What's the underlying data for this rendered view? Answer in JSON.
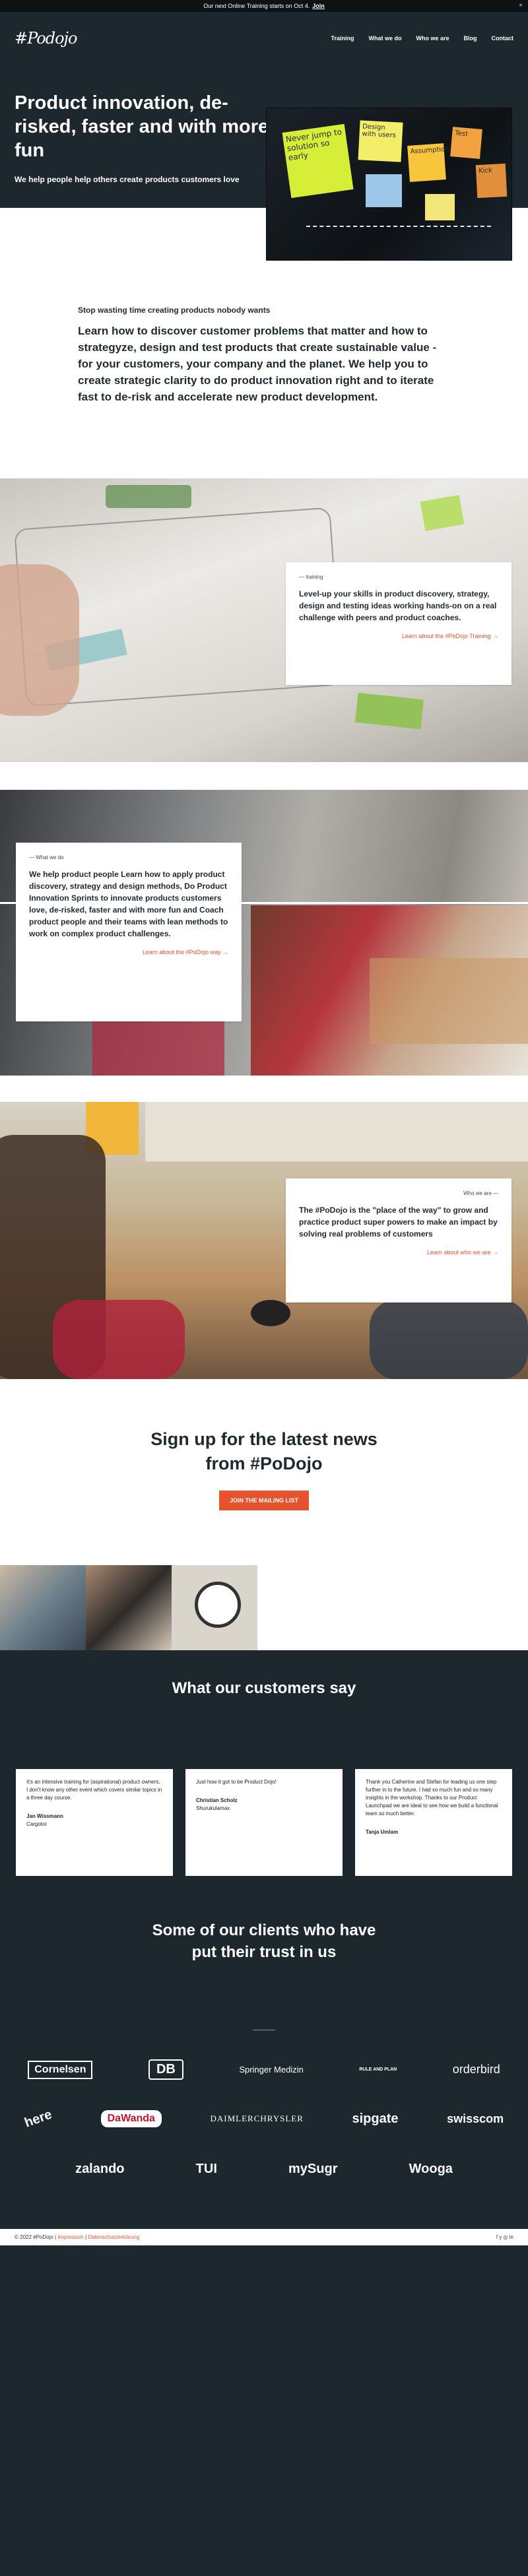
{
  "topbar": {
    "text": "Our next Online Training starts on Oct 4.",
    "join": "Join"
  },
  "nav": {
    "logo": "#Podojo",
    "items": [
      "Training",
      "What we do",
      "Who we are",
      "Blog",
      "Contact"
    ]
  },
  "hero": {
    "title": "Product innovation, de-risked, faster and with more fun",
    "subtitle": "We help people help others create products customers love",
    "notes": [
      "Never jump to solution so early",
      "Design with users",
      "Assumption",
      "Test",
      "Kick"
    ]
  },
  "intro": {
    "kicker": "Stop wasting time creating products nobody wants",
    "body": "Learn how to discover customer problems that matter and how to strategyze, design and test products that create sustainable value - for your customers, your company and the planet. We help you to create strategic clarity to do product innovation right and to iterate fast to de-risk and accelerate new product development."
  },
  "training": {
    "label": "— training",
    "body": "Level-up your skills in product discovery, strategy, design and testing ideas working hands-on on a real challenge with peers and product coaches.",
    "link": "Learn about the #PoDojo Training →"
  },
  "whatwedo": {
    "label": "— What we do",
    "body": "We help product people Learn how to apply product discovery, strategy and design methods, Do Product Innovation Sprints to innovate products customers love, de-risked, faster and with more fun and Coach product people and their teams with lean methods to work on complex product challenges.",
    "link": "Learn about the #PoDojo way →"
  },
  "whoweare": {
    "label": "Who we are —",
    "body": "The #PoDojo is the \"place of the way\" to grow and practice product super powers to make an impact by solving real problems of customers",
    "link": "Learn about who we are →"
  },
  "signup": {
    "title_line1": "Sign up for the latest news",
    "title_line2": "from #PoDojo",
    "button": "JOIN THE MAILING LIST"
  },
  "testimonials": {
    "title": "What our customers say",
    "items": [
      {
        "quote": "It's an intensive training for (aspirational) product owners. I don't know any other event which covers similar topics in a three day course.",
        "name": "Jan Wissmann",
        "company": "Cargotor"
      },
      {
        "quote": "Just how it got to be Product Dojo!",
        "name": "Christian Scholz",
        "company": "Shurukulamax"
      },
      {
        "quote": "Thank you Catherine and Stefan for leading us one step further in to the future. I had so much fun and so many insights in the workshop. Thanks to our Product Launchpad we are ideal to see how we build a functional team so much better.",
        "name": "Tanja Umlam",
        "company": ""
      }
    ]
  },
  "clients": {
    "title_line1": "Some of our clients who have",
    "title_line2": "put their trust in us",
    "row1": [
      "Cornelsen",
      "DB",
      "Springer Medizin",
      "RULE AND PLAN",
      "orderbird"
    ],
    "row2": [
      "here",
      "DaWanda",
      "DAIMLERCHRYSLER",
      "sipgate",
      "swisscom"
    ],
    "row3": [
      "zalando",
      "TUI",
      "mySugr",
      "Wooga"
    ]
  },
  "footer": {
    "copyright": "© 2022 #PoDojo",
    "link1": "Impressum",
    "link2": "Datenschutzerklärung",
    "social": "f  y  ◎  in"
  }
}
